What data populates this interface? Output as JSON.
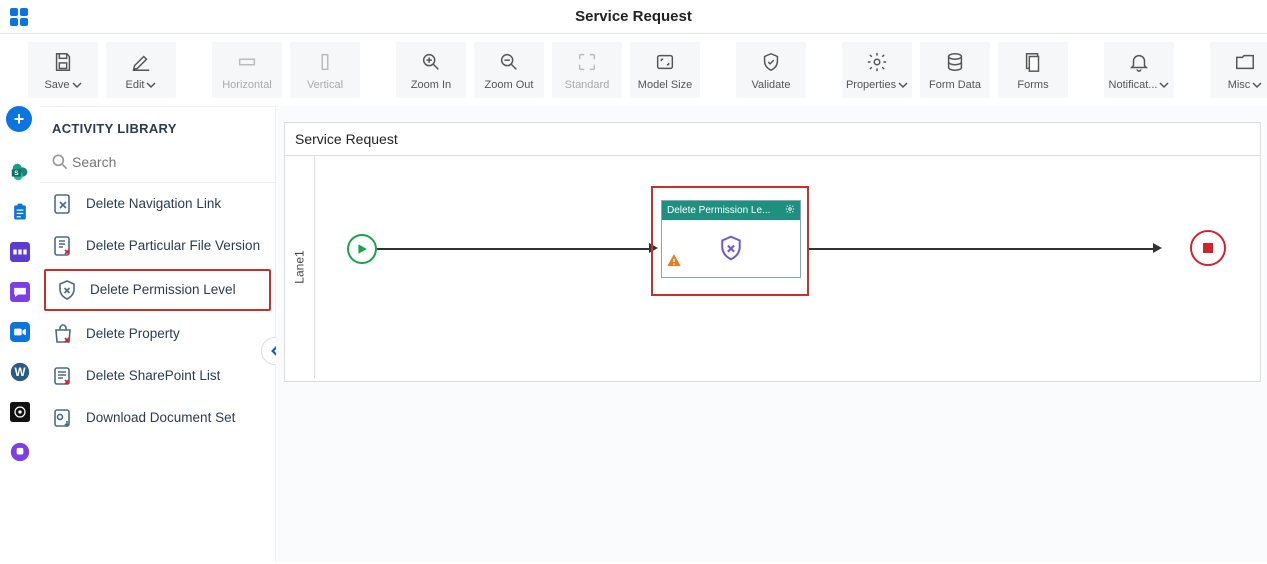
{
  "header": {
    "title": "Service Request"
  },
  "toolbar": {
    "save": "Save",
    "edit": "Edit",
    "horizontal": "Horizontal",
    "vertical": "Vertical",
    "zoom_in": "Zoom In",
    "zoom_out": "Zoom Out",
    "standard": "Standard",
    "model_size": "Model Size",
    "validate": "Validate",
    "properties": "Properties",
    "form_data": "Form Data",
    "forms": "Forms",
    "notifications": "Notificat...",
    "misc": "Misc"
  },
  "sidebar": {
    "title": "ACTIVITY LIBRARY",
    "search_placeholder": "Search",
    "items": [
      {
        "label": "Delete Navigation Link"
      },
      {
        "label": "Delete Particular File Version"
      },
      {
        "label": "Delete Permission Level"
      },
      {
        "label": "Delete Property"
      },
      {
        "label": "Delete SharePoint List"
      },
      {
        "label": "Download Document Set"
      }
    ]
  },
  "canvas": {
    "pool_title": "Service Request",
    "lane_label": "Lane1",
    "task_title": "Delete Permission Le..."
  }
}
